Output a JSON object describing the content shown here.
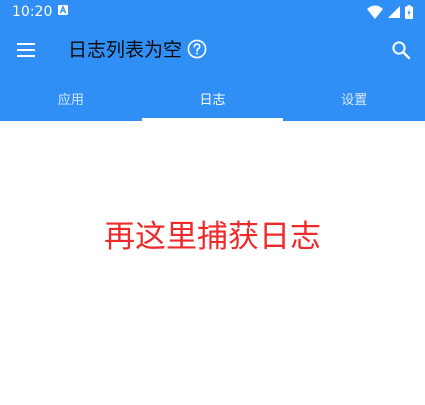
{
  "status_bar": {
    "time": "10:20",
    "notification_icon": "a-notification-icon",
    "wifi_icon": "wifi-icon",
    "signal_icon": "signal-icon",
    "battery_icon": "battery-icon"
  },
  "toolbar": {
    "menu_icon": "menu-icon",
    "title": "日志列表为空",
    "help_icon": "help-icon",
    "search_icon": "search-icon"
  },
  "tabs": [
    {
      "label": "应用",
      "active": false
    },
    {
      "label": "日志",
      "active": true
    },
    {
      "label": "设置",
      "active": false
    }
  ],
  "main": {
    "hint_text": "再这里捕获日志"
  },
  "colors": {
    "app_bar": "#2f8ff5",
    "hint_text": "#ee2a2a",
    "tab_indicator": "#ffffff"
  }
}
